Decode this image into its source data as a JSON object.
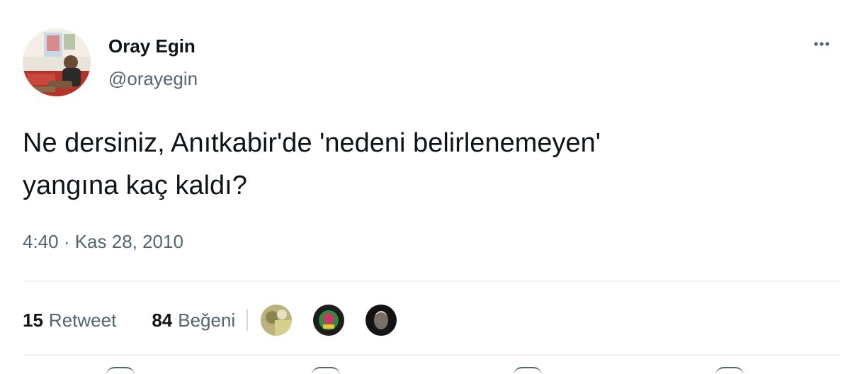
{
  "tweet": {
    "display_name": "Oray Egin",
    "handle": "@orayegin",
    "text_line1": "Ne dersiniz, Anıtkabir'de 'nedeni belirlenemeyen'",
    "text_line2": "yangına kaç kaldı?",
    "timestamp": "4:40 · Kas 28, 2010"
  },
  "stats": {
    "retweets_count": "15",
    "retweets_label": "Retweet",
    "likes_count": "84",
    "likes_label": "Beğeni"
  },
  "icons": {
    "more": "more-horizontal-icon"
  },
  "colors": {
    "text": "#0f1419",
    "secondary": "#536471",
    "divider": "#eff3f4"
  }
}
